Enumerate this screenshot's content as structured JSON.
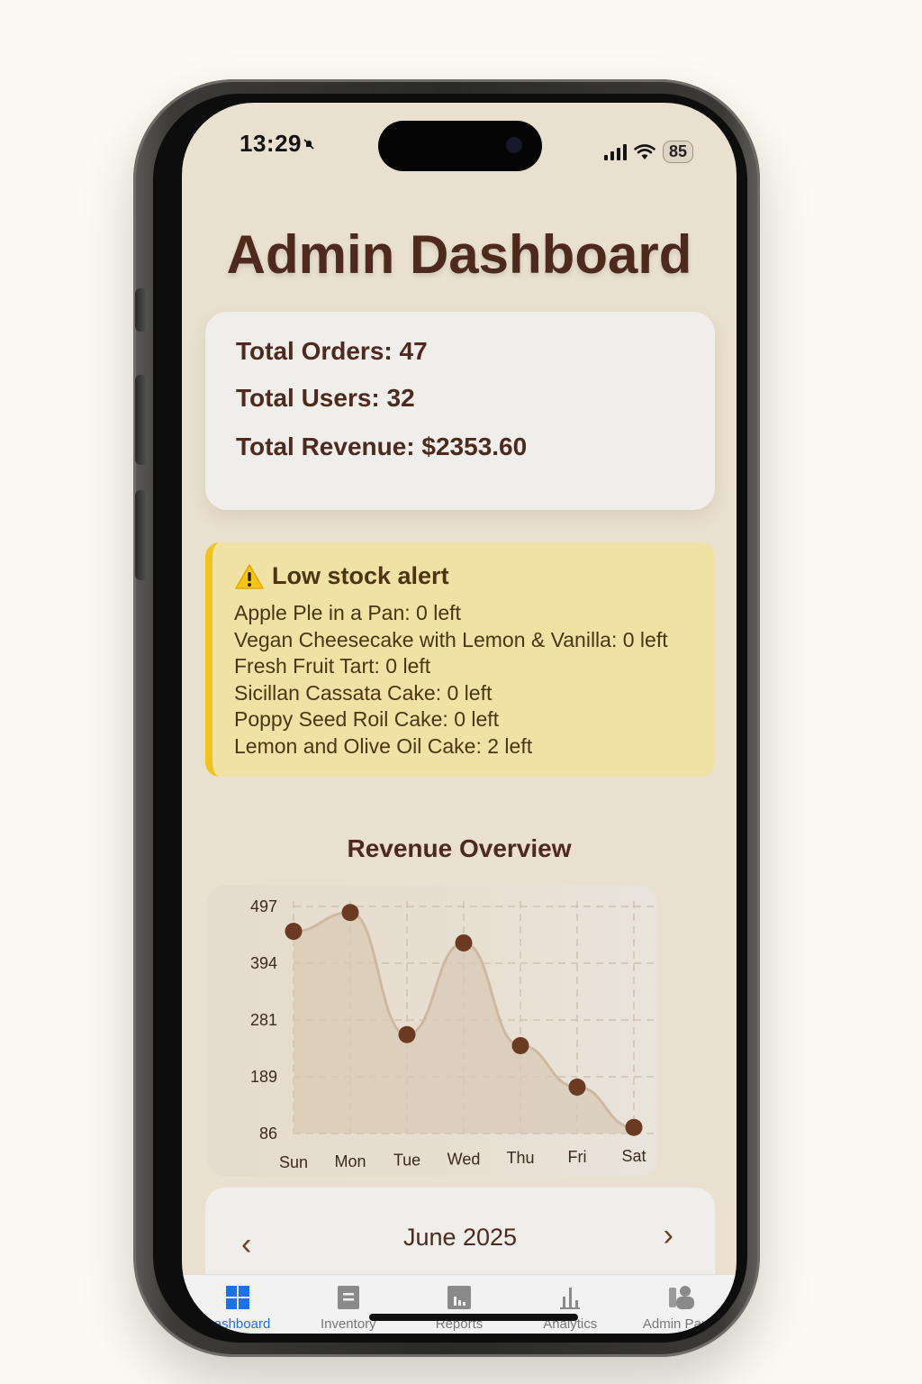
{
  "status_bar": {
    "time": "13:29",
    "battery": "85"
  },
  "header": {
    "title": "Admin Dashboard"
  },
  "stats": {
    "orders": "Total Orders: 47",
    "users": "Total Users: 32",
    "revenue": "Total Revenue: $2353.60"
  },
  "alert": {
    "title": "Low stock alert",
    "items": [
      "Apple Ple in a Pan: 0 left",
      "Vegan Cheesecake with Lemon & Vanilla: 0 left",
      "Fresh Fruit Tart: 0 left",
      "Sicillan Cassata Cake: 0 left",
      "Poppy Seed Roil Cake: 0 left",
      "Lemon and Olive Oil Cake: 2 left"
    ]
  },
  "chart_data": {
    "type": "area",
    "title": "Revenue Overview",
    "categories": [
      "Sun",
      "Mon",
      "Tue",
      "Wed",
      "Thu",
      "Fri",
      "Sat"
    ],
    "values": [
      452,
      486,
      265,
      431,
      245,
      170,
      97
    ],
    "yticks": [
      "497",
      "394",
      "281",
      "189",
      "86"
    ],
    "ylim": [
      86,
      497
    ],
    "xlabel": "",
    "ylabel": "",
    "grid": true,
    "colors": {
      "line": "#cdb9a2",
      "fill": "#d8c9b5",
      "point": "#6b3a22"
    }
  },
  "calendar": {
    "month": "June 2025",
    "prev": "‹",
    "next": "›"
  },
  "tabs": [
    {
      "label": "Dashboard",
      "icon": "grid-icon",
      "active": true
    },
    {
      "label": "Inventory",
      "icon": "document-icon",
      "active": false
    },
    {
      "label": "Reports",
      "icon": "bar-chart-icon",
      "active": false
    },
    {
      "label": "Analytics",
      "icon": "analytics-icon",
      "active": false
    },
    {
      "label": "Admin Panel",
      "icon": "users-icon",
      "active": false
    }
  ],
  "theme": {
    "accent": "#4d2a1d",
    "tab_active": "#1f6ff0",
    "alert_bg": "#f0e1a4",
    "alert_border": "#f1c31c"
  }
}
